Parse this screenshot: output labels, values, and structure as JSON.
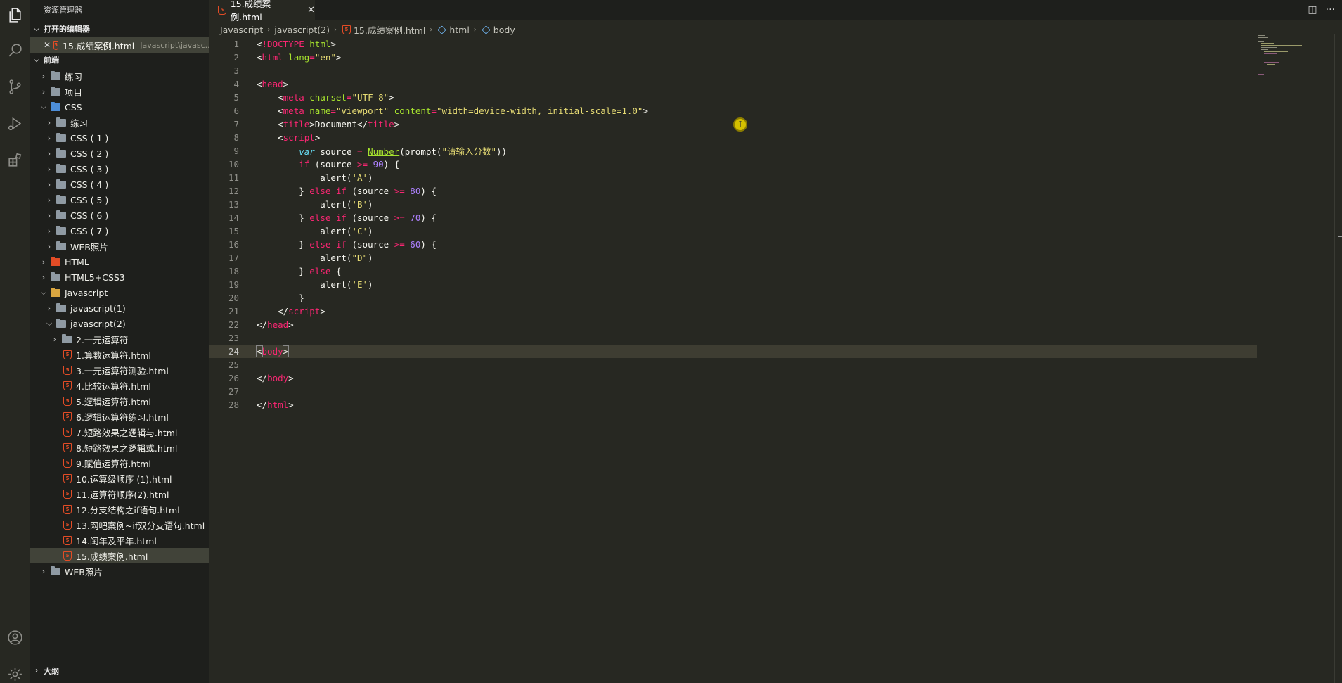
{
  "sidebar": {
    "title": "资源管理器",
    "open_editors": {
      "label": "打开的编辑器",
      "item": {
        "close": "✕",
        "name": "15.成绩案例.html",
        "path": "Javascript\\javasc..."
      }
    },
    "workspace": "前端",
    "outline": "大纲",
    "tree": [
      {
        "label": "练习",
        "depth": 1,
        "kind": "folder",
        "chev": "closed",
        "color": "grey"
      },
      {
        "label": "项目",
        "depth": 1,
        "kind": "folder",
        "chev": "closed",
        "color": "grey"
      },
      {
        "label": "CSS",
        "depth": 1,
        "kind": "folder",
        "chev": "open",
        "color": "blue"
      },
      {
        "label": "练习",
        "depth": 2,
        "kind": "folder",
        "chev": "closed",
        "color": "grey"
      },
      {
        "label": "CSS ( 1 )",
        "depth": 2,
        "kind": "folder",
        "chev": "closed",
        "color": "grey"
      },
      {
        "label": "CSS ( 2 )",
        "depth": 2,
        "kind": "folder",
        "chev": "closed",
        "color": "grey"
      },
      {
        "label": "CSS ( 3 )",
        "depth": 2,
        "kind": "folder",
        "chev": "closed",
        "color": "grey"
      },
      {
        "label": "CSS ( 4 )",
        "depth": 2,
        "kind": "folder",
        "chev": "closed",
        "color": "grey"
      },
      {
        "label": "CSS ( 5 )",
        "depth": 2,
        "kind": "folder",
        "chev": "closed",
        "color": "grey"
      },
      {
        "label": "CSS ( 6 )",
        "depth": 2,
        "kind": "folder",
        "chev": "closed",
        "color": "grey"
      },
      {
        "label": "CSS ( 7 )",
        "depth": 2,
        "kind": "folder",
        "chev": "closed",
        "color": "grey"
      },
      {
        "label": "WEB照片",
        "depth": 2,
        "kind": "folder",
        "chev": "closed",
        "color": "grey"
      },
      {
        "label": "HTML",
        "depth": 1,
        "kind": "folder",
        "chev": "closed",
        "color": "red"
      },
      {
        "label": "HTML5+CSS3",
        "depth": 1,
        "kind": "folder",
        "chev": "closed",
        "color": "grey"
      },
      {
        "label": "Javascript",
        "depth": 1,
        "kind": "folder",
        "chev": "open",
        "color": "orange"
      },
      {
        "label": "javascript(1)",
        "depth": 2,
        "kind": "folder",
        "chev": "closed",
        "color": "grey"
      },
      {
        "label": "javascript(2)",
        "depth": 2,
        "kind": "folder",
        "chev": "open",
        "color": "grey"
      },
      {
        "label": "2.一元运算符",
        "depth": 3,
        "kind": "folder",
        "chev": "closed",
        "color": "grey"
      },
      {
        "label": "1.算数运算符.html",
        "depth": 3,
        "kind": "file"
      },
      {
        "label": "3.一元运算符测验.html",
        "depth": 3,
        "kind": "file"
      },
      {
        "label": "4.比较运算符.html",
        "depth": 3,
        "kind": "file"
      },
      {
        "label": "5.逻辑运算符.html",
        "depth": 3,
        "kind": "file"
      },
      {
        "label": "6.逻辑运算符练习.html",
        "depth": 3,
        "kind": "file"
      },
      {
        "label": "7.短路效果之逻辑与.html",
        "depth": 3,
        "kind": "file"
      },
      {
        "label": "8.短路效果之逻辑或.html",
        "depth": 3,
        "kind": "file"
      },
      {
        "label": "9.赋值运算符.html",
        "depth": 3,
        "kind": "file"
      },
      {
        "label": "10.运算级顺序 (1).html",
        "depth": 3,
        "kind": "file"
      },
      {
        "label": "11.运算符顺序(2).html",
        "depth": 3,
        "kind": "file"
      },
      {
        "label": "12.分支结构之if语句.html",
        "depth": 3,
        "kind": "file"
      },
      {
        "label": "13.网吧案例~if双分支语句.html",
        "depth": 3,
        "kind": "file"
      },
      {
        "label": "14.闰年及平年.html",
        "depth": 3,
        "kind": "file"
      },
      {
        "label": "15.成绩案例.html",
        "depth": 3,
        "kind": "file",
        "selected": true
      },
      {
        "label": "WEB照片",
        "depth": 1,
        "kind": "folder",
        "chev": "closed",
        "color": "grey"
      }
    ]
  },
  "tab": {
    "label": "15.成绩案例.html",
    "close": "✕"
  },
  "tab_actions": {
    "split": "◫",
    "more": "···"
  },
  "breadcrumb": [
    "Javascript",
    "javascript(2)",
    "15.成绩案例.html",
    "html",
    "body"
  ],
  "code": [
    {
      "n": "1",
      "t": [
        [
          "p",
          "<"
        ],
        [
          "k",
          "!DOCTYPE"
        ],
        [
          "p",
          " "
        ],
        [
          "a",
          "html"
        ],
        [
          "p",
          ">"
        ]
      ]
    },
    {
      "n": "2",
      "t": [
        [
          "p",
          "<"
        ],
        [
          "k",
          "html"
        ],
        [
          "p",
          " "
        ],
        [
          "a",
          "lang"
        ],
        [
          "k",
          "="
        ],
        [
          "s",
          "\"en\""
        ],
        [
          "p",
          ">"
        ]
      ]
    },
    {
      "n": "3",
      "t": []
    },
    {
      "n": "4",
      "t": [
        [
          "p",
          "<"
        ],
        [
          "k",
          "head"
        ],
        [
          "p",
          ">"
        ]
      ]
    },
    {
      "n": "5",
      "t": [
        [
          "p",
          "    <"
        ],
        [
          "k",
          "meta"
        ],
        [
          "p",
          " "
        ],
        [
          "a",
          "charset"
        ],
        [
          "k",
          "="
        ],
        [
          "s",
          "\"UTF-8\""
        ],
        [
          "p",
          ">"
        ]
      ]
    },
    {
      "n": "6",
      "t": [
        [
          "p",
          "    <"
        ],
        [
          "k",
          "meta"
        ],
        [
          "p",
          " "
        ],
        [
          "a",
          "name"
        ],
        [
          "k",
          "="
        ],
        [
          "s",
          "\"viewport\""
        ],
        [
          "p",
          " "
        ],
        [
          "a",
          "content"
        ],
        [
          "k",
          "="
        ],
        [
          "s",
          "\"width=device-width, initial-scale=1.0\""
        ],
        [
          "p",
          ">"
        ]
      ]
    },
    {
      "n": "7",
      "t": [
        [
          "p",
          "    <"
        ],
        [
          "k",
          "title"
        ],
        [
          "p",
          ">Document</"
        ],
        [
          "k",
          "title"
        ],
        [
          "p",
          ">"
        ]
      ]
    },
    {
      "n": "8",
      "t": [
        [
          "p",
          "    <"
        ],
        [
          "k",
          "script"
        ],
        [
          "p",
          ">"
        ]
      ]
    },
    {
      "n": "9",
      "t": [
        [
          "p",
          "        "
        ],
        [
          "v",
          "var"
        ],
        [
          "p",
          " source "
        ],
        [
          "k",
          "="
        ],
        [
          "p",
          " "
        ],
        [
          "f",
          "Number"
        ],
        [
          "p",
          "(prompt("
        ],
        [
          "s",
          "\"请输入分数\""
        ],
        [
          "p",
          "))"
        ]
      ]
    },
    {
      "n": "10",
      "t": [
        [
          "p",
          "        "
        ],
        [
          "k",
          "if"
        ],
        [
          "p",
          " (source "
        ],
        [
          "k",
          ">="
        ],
        [
          "p",
          " "
        ],
        [
          "n",
          "90"
        ],
        [
          "p",
          ") {"
        ]
      ]
    },
    {
      "n": "11",
      "t": [
        [
          "p",
          "            alert("
        ],
        [
          "s",
          "'A'"
        ],
        [
          "p",
          ")"
        ]
      ]
    },
    {
      "n": "12",
      "t": [
        [
          "p",
          "        } "
        ],
        [
          "k",
          "else"
        ],
        [
          "p",
          " "
        ],
        [
          "k",
          "if"
        ],
        [
          "p",
          " (source "
        ],
        [
          "k",
          ">="
        ],
        [
          "p",
          " "
        ],
        [
          "n",
          "80"
        ],
        [
          "p",
          ") {"
        ]
      ]
    },
    {
      "n": "13",
      "t": [
        [
          "p",
          "            alert("
        ],
        [
          "s",
          "'B'"
        ],
        [
          "p",
          ")"
        ]
      ]
    },
    {
      "n": "14",
      "t": [
        [
          "p",
          "        } "
        ],
        [
          "k",
          "else"
        ],
        [
          "p",
          " "
        ],
        [
          "k",
          "if"
        ],
        [
          "p",
          " (source "
        ],
        [
          "k",
          ">="
        ],
        [
          "p",
          " "
        ],
        [
          "n",
          "70"
        ],
        [
          "p",
          ") {"
        ]
      ]
    },
    {
      "n": "15",
      "t": [
        [
          "p",
          "            alert("
        ],
        [
          "s",
          "'C'"
        ],
        [
          "p",
          ")"
        ]
      ]
    },
    {
      "n": "16",
      "t": [
        [
          "p",
          "        } "
        ],
        [
          "k",
          "else"
        ],
        [
          "p",
          " "
        ],
        [
          "k",
          "if"
        ],
        [
          "p",
          " (source "
        ],
        [
          "k",
          ">="
        ],
        [
          "p",
          " "
        ],
        [
          "n",
          "60"
        ],
        [
          "p",
          ") {"
        ]
      ]
    },
    {
      "n": "17",
      "t": [
        [
          "p",
          "            alert("
        ],
        [
          "s",
          "\"D\""
        ],
        [
          "p",
          ")"
        ]
      ]
    },
    {
      "n": "18",
      "t": [
        [
          "p",
          "        } "
        ],
        [
          "k",
          "else"
        ],
        [
          "p",
          " {"
        ]
      ]
    },
    {
      "n": "19",
      "t": [
        [
          "p",
          "            alert("
        ],
        [
          "s",
          "'E'"
        ],
        [
          "p",
          ")"
        ]
      ]
    },
    {
      "n": "20",
      "t": [
        [
          "p",
          "        }"
        ]
      ]
    },
    {
      "n": "21",
      "t": [
        [
          "p",
          "    </"
        ],
        [
          "k",
          "script"
        ],
        [
          "p",
          ">"
        ]
      ]
    },
    {
      "n": "22",
      "t": [
        [
          "p",
          "</"
        ],
        [
          "k",
          "head"
        ],
        [
          "p",
          ">"
        ]
      ]
    },
    {
      "n": "23",
      "t": []
    },
    {
      "n": "24",
      "t": [
        [
          "p",
          "<"
        ],
        [
          "k",
          "body"
        ],
        [
          "p",
          ">"
        ]
      ],
      "current": true
    },
    {
      "n": "25",
      "t": []
    },
    {
      "n": "26",
      "t": [
        [
          "p",
          "</"
        ],
        [
          "k",
          "body"
        ],
        [
          "p",
          ">"
        ]
      ]
    },
    {
      "n": "27",
      "t": []
    },
    {
      "n": "28",
      "t": [
        [
          "p",
          "</"
        ],
        [
          "k",
          "html"
        ],
        [
          "p",
          ">"
        ]
      ]
    }
  ],
  "colors": {
    "accent": "#e34c26",
    "background": "#272822",
    "sidebar": "#1e1f1c",
    "selection": "#414339"
  }
}
